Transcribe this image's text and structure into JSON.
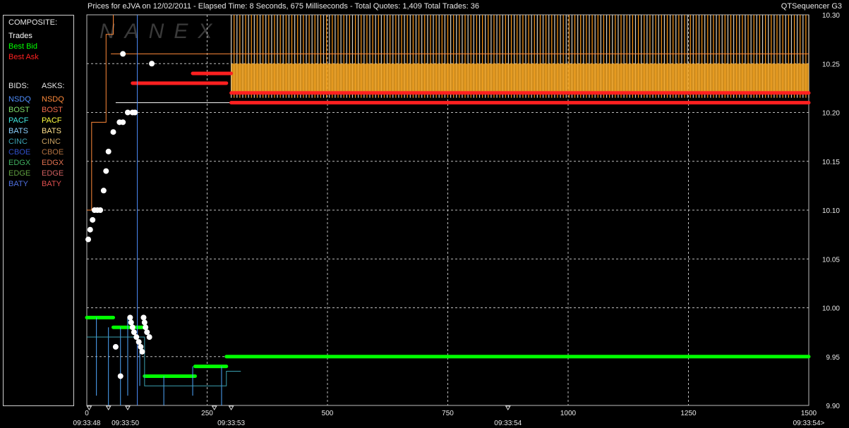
{
  "header": {
    "title": "Prices for  eJVA  on  12/02/2011  -  Elapsed Time: 8 Seconds, 675 Milliseconds  -  Total Quotes: 1,409  Total Trades: 36",
    "app": "QTSequencer G3",
    "watermark": "NANEX"
  },
  "legend": {
    "composite_label": "COMPOSITE:",
    "composite": [
      {
        "label": "Trades",
        "color": "#ffffff"
      },
      {
        "label": "Best Bid",
        "color": "#00ff00"
      },
      {
        "label": "Best Ask",
        "color": "#ff2020"
      }
    ],
    "bids_label": "BIDS:",
    "asks_label": "ASKS:",
    "exchanges": [
      {
        "bid": "NSDQ",
        "bid_color": "#4f8fff",
        "ask": "NSDQ",
        "ask_color": "#ff8a3a"
      },
      {
        "bid": "BOST",
        "bid_color": "#7ddc6a",
        "ask": "BOST",
        "ask_color": "#f06a4a"
      },
      {
        "bid": "PACF",
        "bid_color": "#40e8e0",
        "ask": "PACF",
        "ask_color": "#ffff40"
      },
      {
        "bid": "BATS",
        "bid_color": "#8ad0ff",
        "ask": "BATS",
        "ask_color": "#ffe08a"
      },
      {
        "bid": "CINC",
        "bid_color": "#3aa0b0",
        "ask": "CINC",
        "ask_color": "#c8a060"
      },
      {
        "bid": "CBOE",
        "bid_color": "#3050c8",
        "ask": "CBOE",
        "ask_color": "#b07040"
      },
      {
        "bid": "EDGX",
        "bid_color": "#40b060",
        "ask": "EDGX",
        "ask_color": "#e07050"
      },
      {
        "bid": "EDGE",
        "bid_color": "#60a040",
        "ask": "EDGE",
        "ask_color": "#d06060"
      },
      {
        "bid": "BATY",
        "bid_color": "#5070e0",
        "ask": "BATY",
        "ask_color": "#e05050"
      }
    ]
  },
  "chart_data": {
    "type": "line",
    "y_ticks": [
      "10.30",
      "10.25",
      "10.20",
      "10.15",
      "10.10",
      "10.05",
      "10.00",
      "9.95",
      "9.90"
    ],
    "ylim": [
      9.9,
      10.3
    ],
    "x_ticks": [
      "0",
      "250",
      "500",
      "750",
      "1000",
      "1250",
      "1500"
    ],
    "xlim": [
      0,
      1500
    ],
    "time_labels": [
      {
        "x": 0,
        "label": "09:33:48"
      },
      {
        "x": 80,
        "label": "09:33:50"
      },
      {
        "x": 300,
        "label": "09:33:53"
      },
      {
        "x": 875,
        "label": "09:33:54"
      },
      {
        "x": 1500,
        "label": "09:33:54>"
      }
    ],
    "grid": true,
    "series": [
      {
        "name": "Trades",
        "color": "#ffffff",
        "points": [
          [
            3,
            10.07
          ],
          [
            7,
            10.08
          ],
          [
            12,
            10.09
          ],
          [
            16,
            10.1
          ],
          [
            22,
            10.1
          ],
          [
            28,
            10.1
          ],
          [
            35,
            10.12
          ],
          [
            40,
            10.14
          ],
          [
            45,
            10.16
          ],
          [
            55,
            10.18
          ],
          [
            68,
            10.19
          ],
          [
            75,
            10.19
          ],
          [
            85,
            10.2
          ],
          [
            95,
            10.2
          ],
          [
            100,
            10.2
          ],
          [
            90,
            9.99
          ],
          [
            92,
            9.985
          ],
          [
            95,
            9.98
          ],
          [
            98,
            9.975
          ],
          [
            103,
            9.97
          ],
          [
            108,
            9.965
          ],
          [
            112,
            9.96
          ],
          [
            115,
            9.955
          ],
          [
            118,
            9.99
          ],
          [
            120,
            9.985
          ],
          [
            122,
            9.98
          ],
          [
            125,
            9.975
          ],
          [
            130,
            9.97
          ],
          [
            60,
            9.96
          ],
          [
            70,
            9.93
          ],
          [
            75,
            10.26
          ],
          [
            135,
            10.25
          ]
        ]
      },
      {
        "name": "Best Bid",
        "color": "#00ff00",
        "bands": [
          {
            "x0": 0,
            "x1": 55,
            "y": 9.99
          },
          {
            "x0": 55,
            "x1": 120,
            "y": 9.98
          },
          {
            "x0": 120,
            "x1": 225,
            "y": 9.93
          },
          {
            "x0": 225,
            "x1": 290,
            "y": 9.94
          },
          {
            "x0": 290,
            "x1": 1500,
            "y": 9.95
          }
        ]
      },
      {
        "name": "Best Ask",
        "color": "#ff2020",
        "bands": [
          {
            "x0": 95,
            "x1": 290,
            "y": 10.23
          },
          {
            "x0": 220,
            "x1": 300,
            "y": 10.24
          },
          {
            "x0": 300,
            "x1": 1500,
            "y": 10.22
          },
          {
            "x0": 300,
            "x1": 1500,
            "y": 10.21
          }
        ]
      }
    ]
  }
}
